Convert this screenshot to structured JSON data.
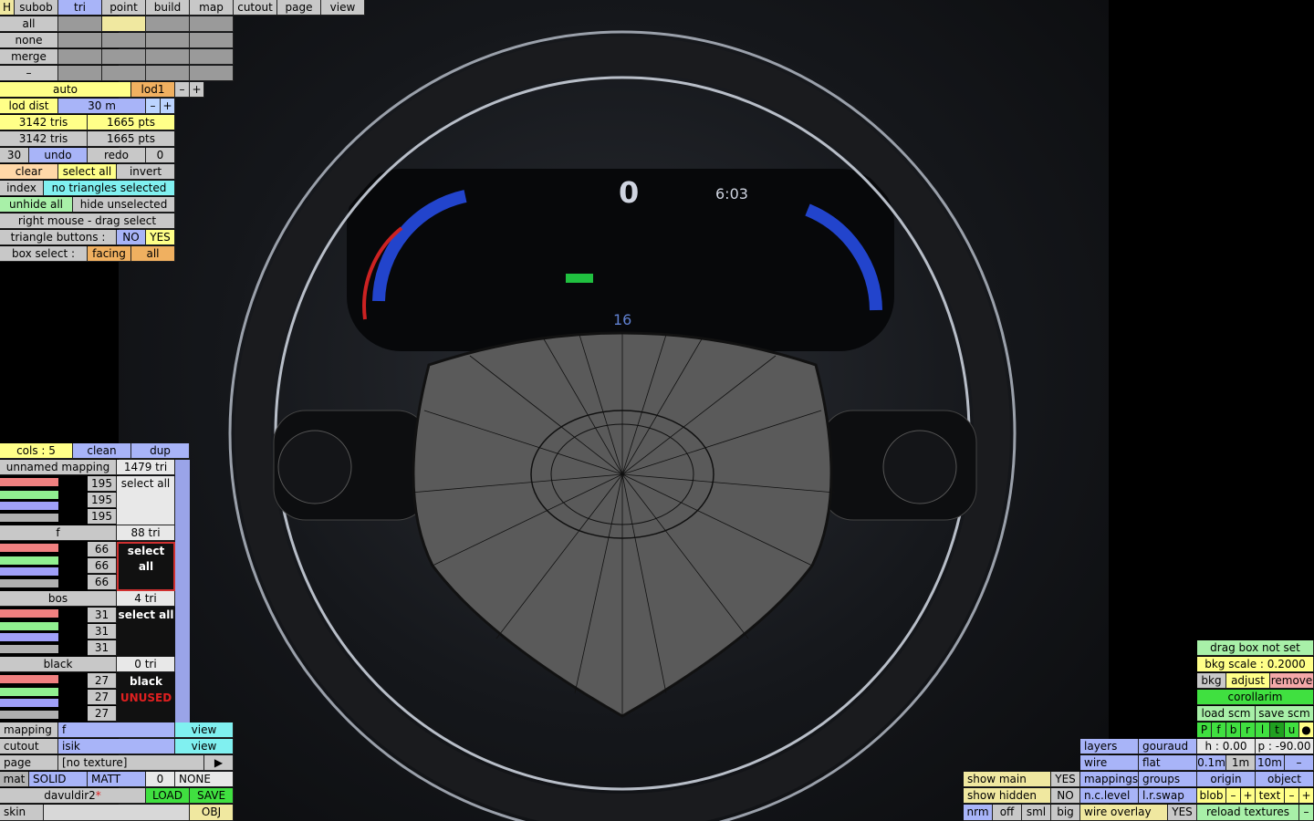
{
  "top_tabs": {
    "h": "H",
    "subob": "subob",
    "tri": "tri",
    "point": "point",
    "build": "build",
    "map": "map",
    "cutout": "cutout",
    "page": "page",
    "view": "view"
  },
  "select_buttons": {
    "all": "all",
    "none": "none",
    "merge": "merge",
    "minus": "–"
  },
  "lod": {
    "auto": "auto",
    "lod1": "lod1",
    "minus": "–",
    "plus": "+",
    "lod_dist_label": "lod dist",
    "lod_dist_value": "30 m"
  },
  "stats": {
    "tris_a": "3142 tris",
    "pts_a": "1665 pts",
    "tris_b": "3142 tris",
    "pts_b": "1665 pts"
  },
  "history": {
    "left_count": "30",
    "undo": "undo",
    "redo": "redo",
    "right_count": "0"
  },
  "selection": {
    "clear": "clear",
    "select_all": "select all",
    "invert": "invert",
    "index": "index",
    "status": "no triangles selected",
    "unhide_all": "unhide all",
    "hide_unselected": "hide unselected",
    "hint": "right mouse - drag select"
  },
  "triangle_buttons": {
    "label": "triangle buttons :",
    "no": "NO",
    "yes": "YES"
  },
  "box_select": {
    "label": "box select :",
    "facing": "facing",
    "all": "all"
  },
  "materials_header": {
    "cols": "cols : 5",
    "clean": "clean",
    "dup": "dup"
  },
  "materials": [
    {
      "name": "unnamed mapping",
      "tri": "1479 tri",
      "values": [
        "195",
        "195",
        "195"
      ],
      "block": "select all",
      "block2": ""
    },
    {
      "name": "f",
      "tri": "88 tri",
      "values": [
        "66",
        "66",
        "66"
      ],
      "block": "select all",
      "block2": ""
    },
    {
      "name": "bos",
      "tri": "4 tri",
      "values": [
        "31",
        "31",
        "31"
      ],
      "block": "select all",
      "block2": ""
    },
    {
      "name": "black",
      "tri": "0 tri",
      "values": [
        "27",
        "27",
        "27"
      ],
      "block": "black",
      "block2": "UNUSED"
    }
  ],
  "bottom_left": {
    "mapping_label": "mapping",
    "mapping_value": "f",
    "mapping_view": "view",
    "cutout_label": "cutout",
    "cutout_value": "isik",
    "cutout_view": "view",
    "page_label": "page",
    "page_value": "[no texture]",
    "page_arrow": "▶",
    "mat": "mat",
    "solid": "SOLID",
    "matt": "MATT",
    "zero": "0",
    "none": "NONE",
    "file": "davuldir2",
    "file_mark": "*",
    "load": "LOAD",
    "save": "SAVE",
    "skin": "skin",
    "obj": "OBJ"
  },
  "bottom_right": {
    "drag_box": "drag box not set",
    "bkg_scale": "bkg scale : 0.2000",
    "bkg": "bkg",
    "adjust": "adjust",
    "remove": "remove",
    "texture_name": "corollarim",
    "load_scm": "load scm",
    "save_scm": "save scm",
    "view_letters": [
      "P",
      "f",
      "b",
      "r",
      "l",
      "t",
      "u",
      "●"
    ],
    "h": "h : 0.00",
    "p": "p : -90.00",
    "layers": "layers",
    "gouraud": "gouraud",
    "wire": "wire",
    "flat": "flat",
    "d01": "0.1m",
    "d1": "1m",
    "d10": "10m",
    "dminus": "–",
    "show_main": "show main",
    "show_main_val": "YES",
    "mappings": "mappings",
    "groups": "groups",
    "origin": "origin",
    "object": "object",
    "show_hidden": "show hidden",
    "show_hidden_val": "NO",
    "nclevel": "n.c.level",
    "lrswap": "l.r.swap",
    "blob": "blob",
    "minus": "–",
    "plus": "+",
    "text": "text",
    "nrm": "nrm",
    "off": "off",
    "sml": "sml",
    "big": "big",
    "wire_overlay": "wire overlay",
    "wire_overlay_val": "YES",
    "reload": "reload textures"
  },
  "viewport": {
    "speed": "0",
    "time": "6:03",
    "speed2": "16"
  },
  "colors": {
    "accent_blue": "#a8b4f8",
    "yellow": "#ffff88",
    "orange": "#f0b060",
    "green": "#40e040",
    "pink": "#f4a8a8"
  }
}
